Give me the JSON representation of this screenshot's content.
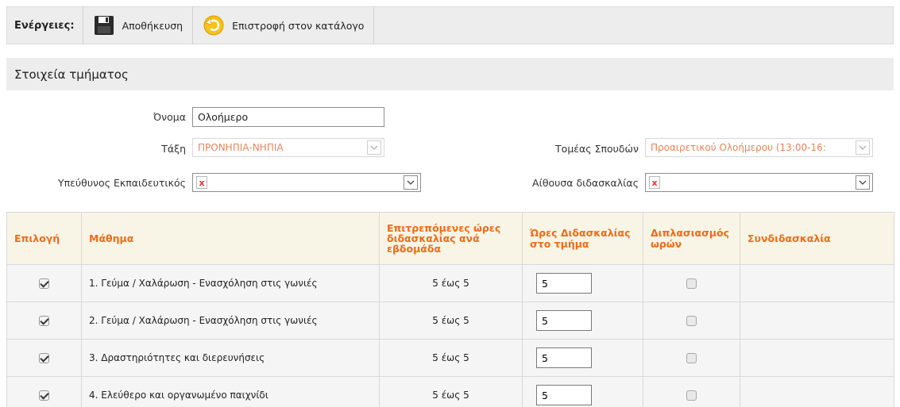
{
  "toolbar": {
    "label": "Ενέργειες:",
    "save_label": "Αποθήκευση",
    "back_label": "Επιστροφή στον κατάλογο"
  },
  "section": {
    "title": "Στοιχεία τμήματος"
  },
  "form": {
    "name_label": "Όνομα",
    "name_value": "Ολοήμερο",
    "class_label": "Τάξη",
    "class_value": "ΠΡΟΝΗΠΙΑ-ΝΗΠΙΑ",
    "sector_label": "Τομέας Σπουδών",
    "sector_value": "Προαιρετικού Ολοήμερου (13:00-16:",
    "teacher_label": "Υπεύθυνος Εκπαιδευτικός",
    "teacher_value": "x",
    "room_label": "Αίθουσα διδασκαλίας",
    "room_value": "x"
  },
  "table": {
    "headers": {
      "select": "Επιλογή",
      "subject": "Μάθημα",
      "allowed": "Επιτρεπόμενες ώρες διδασκαλίας ανά εβδομάδα",
      "hours": "Ώρες Διδασκαλίας στο τμήμα",
      "double": "Διπλασιασμός ωρών",
      "coteach": "Συνδιδασκαλία"
    },
    "rows": [
      {
        "checked": true,
        "subject": "1. Γεύμα / Χαλάρωση - Ενασχόληση στις γωνιές",
        "allowed": "5 έως 5",
        "hours": "5",
        "double": false,
        "coteach": ""
      },
      {
        "checked": true,
        "subject": "2. Γεύμα / Χαλάρωση - Ενασχόληση στις γωνιές",
        "allowed": "5 έως 5",
        "hours": "5",
        "double": false,
        "coteach": ""
      },
      {
        "checked": true,
        "subject": "3. Δραστηριότητες και διερευνήσεις",
        "allowed": "5 έως 5",
        "hours": "5",
        "double": false,
        "coteach": ""
      },
      {
        "checked": true,
        "subject": "4. Ελεύθερο και οργανωμένο παιχνίδι",
        "allowed": "5 έως 5",
        "hours": "5",
        "double": false,
        "coteach": ""
      }
    ]
  }
}
